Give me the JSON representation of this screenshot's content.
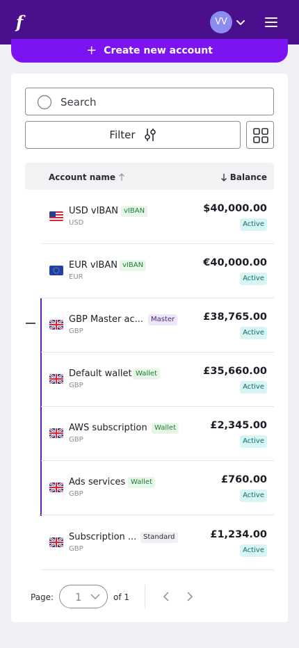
{
  "header": {
    "logo": "f",
    "avatar_initials": "VV"
  },
  "create_button": {
    "plus": "+",
    "label": "Create new account"
  },
  "search": {
    "placeholder": "Search"
  },
  "filter": {
    "label": "Filter"
  },
  "table": {
    "col_name": "Account name",
    "col_balance": "Balance",
    "rows": [
      {
        "name": "USD vIBAN",
        "tag": "vIBAN",
        "currency": "USD",
        "balance": "$40,000.00",
        "status": "Active",
        "flag": "us-flag-icon"
      },
      {
        "name": "EUR vIBAN",
        "tag": "vIBAN",
        "currency": "EUR",
        "balance": "€40,000.00",
        "status": "Active",
        "flag": "eu-flag-icon"
      },
      {
        "name": "GBP Master ac...",
        "tag": "Master",
        "currency": "GBP",
        "balance": "£38,765.00",
        "status": "Active",
        "flag": "uk-flag-icon"
      },
      {
        "name": "Default wallet",
        "tag": "Wallet",
        "currency": "GBP",
        "balance": "£35,660.00",
        "status": "Active",
        "flag": "uk-flag-icon"
      },
      {
        "name": "AWS subscription",
        "tag": "Wallet",
        "currency": "GBP",
        "balance": "£2,345.00",
        "status": "Active",
        "flag": "uk-flag-icon"
      },
      {
        "name": "Ads services",
        "tag": "Wallet",
        "currency": "GBP",
        "balance": "£760.00",
        "status": "Active",
        "flag": "uk-flag-icon"
      },
      {
        "name": "Subscription ...",
        "tag": "Standard",
        "currency": "GBP",
        "balance": "£1,234.00",
        "status": "Active",
        "flag": "uk-flag-icon"
      }
    ]
  },
  "pagination": {
    "label": "Page:",
    "current": "1",
    "of": "of 1"
  },
  "colors": {
    "header": "#4a0f8c",
    "accent": "#7b14f0",
    "group_line": "#6a1bb0"
  }
}
